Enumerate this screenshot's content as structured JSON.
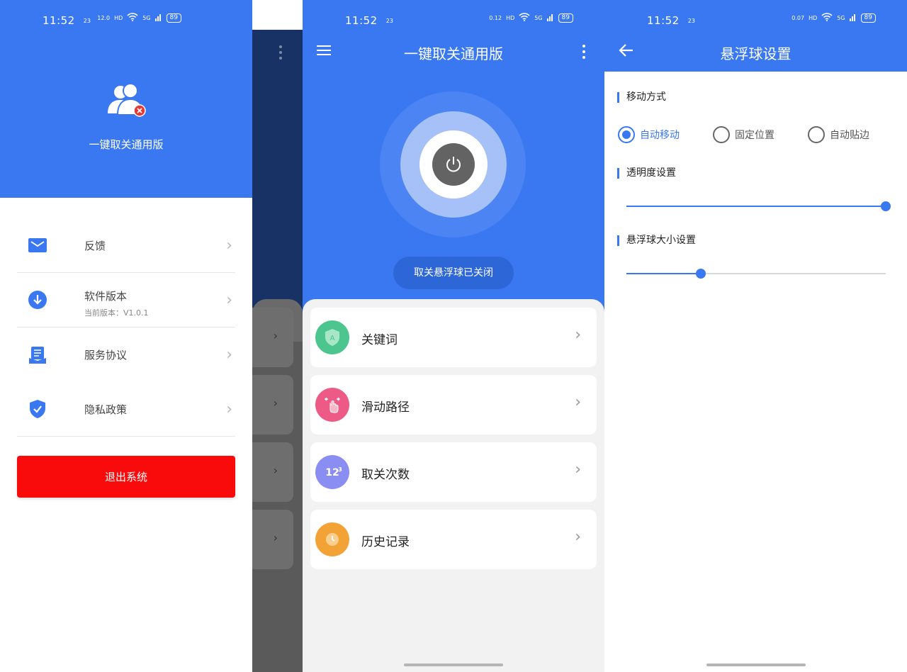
{
  "status_bar": {
    "time": "11:52",
    "indicator": "23",
    "speeds": [
      "12.0",
      "0.12",
      "0.07"
    ],
    "speed_unit": "KB/S",
    "hd": "HD",
    "signal": "5G",
    "battery": "89"
  },
  "drawer": {
    "app_name": "一键取关通用版",
    "items": [
      {
        "label": "反馈",
        "icon": "mail-icon"
      },
      {
        "label": "软件版本",
        "sub": "当前版本：V1.0.1",
        "icon": "download-icon"
      },
      {
        "label": "服务协议",
        "icon": "document-icon"
      },
      {
        "label": "隐私政策",
        "icon": "shield-icon"
      }
    ],
    "logout": "退出系统"
  },
  "main": {
    "title": "一键取关通用版",
    "status_pill": "取关悬浮球已关闭",
    "features": [
      {
        "label": "关键词",
        "color": "#4cc58e",
        "icon": "keyword-icon"
      },
      {
        "label": "滑动路径",
        "color": "#ee5a86",
        "icon": "swipe-hand-icon"
      },
      {
        "label": "取关次数",
        "color": "#8a8df2",
        "icon": "count-123-icon"
      },
      {
        "label": "历史记录",
        "color": "#f3a236",
        "icon": "clock-icon"
      }
    ]
  },
  "settings": {
    "title": "悬浮球设置",
    "move_mode": {
      "title": "移动方式",
      "options": [
        "自动移动",
        "固定位置",
        "自动贴边"
      ],
      "selected": "自动移动"
    },
    "opacity": {
      "title": "透明度设置",
      "value": 1.0
    },
    "size": {
      "title": "悬浮球大小设置",
      "value": 0.286
    }
  },
  "colors": {
    "primary": "#3a78f2",
    "danger": "#fa0b0b",
    "power_button": "#636363"
  }
}
